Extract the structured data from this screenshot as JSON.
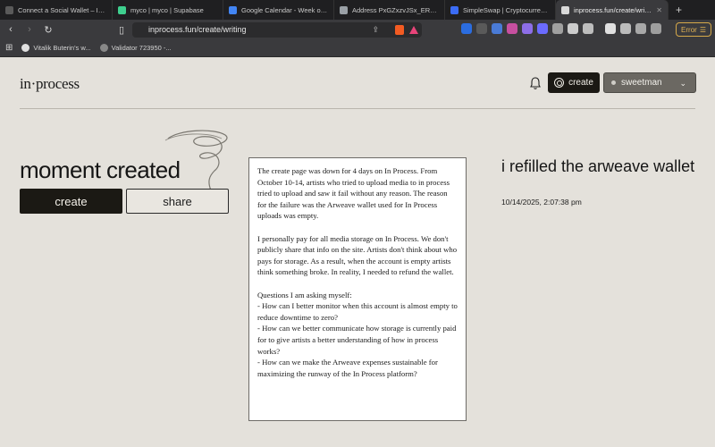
{
  "browser": {
    "tabs": [
      {
        "title": "Connect a Social Wallet – In Pr",
        "color": "#5a5a5a"
      },
      {
        "title": "myco | myco | Supabase",
        "color": "#3ecf8e"
      },
      {
        "title": "Google Calendar - Week of Oct",
        "color": "#4285f4"
      },
      {
        "title": "Address PxGZxzvJSx_ER-Vdec",
        "color": "#9aa0a6"
      },
      {
        "title": "SimpleSwap | Cryptocurrency E",
        "color": "#3b6cf6"
      },
      {
        "title": "inprocess.fun/create/writing",
        "color": "#d9d9d9"
      }
    ],
    "new_tab": "+",
    "url": "inprocess.fun/create/writing",
    "error_label": "Error",
    "bookmarks": [
      {
        "label": "Vitalik Buterin's w...",
        "color": "#e0e0e0"
      },
      {
        "label": "Validator 723950 -...",
        "color": "#888888"
      }
    ],
    "colors": {
      "tab_bg": "#1f1f21",
      "toolbar_bg": "#3a3a3d",
      "error": "#e0b253"
    }
  },
  "header": {
    "logo": "in·process",
    "create_label": "create",
    "user_label": "sweetman"
  },
  "left": {
    "title": "moment created",
    "create_label": "create",
    "share_label": "share"
  },
  "writing": {
    "body": "The create page was down for 4 days on In Process. From October 10-14, artists who tried to upload media to in process tried to upload and saw it fail without any reason. The reason for the failure was the Arweave wallet used for In Process uploads was empty.\n\nI personally pay for all media storage on In Process. We don't publicly share that info on the site. Artists don't think about who pays for storage. As a result, when the account is empty artists think something broke. In reality, I needed to refund the wallet.\n\nQuestions I am asking myself:\n- How can I better monitor when this account is almost empty to reduce downtime to zero?\n- How can we better communicate how storage is currently paid for to give artists a better understanding of how in process works?\n- How can we make the Arweave expenses sustainable for maximizing the runway of the In Process platform?"
  },
  "right": {
    "title": "i refilled the arweave wallet",
    "timestamp": "10/14/2025, 2:07:38 pm"
  },
  "colors": {
    "page_bg": "#e4e1db",
    "dark_button": "#1b1914",
    "user_button": "#6b6862"
  }
}
